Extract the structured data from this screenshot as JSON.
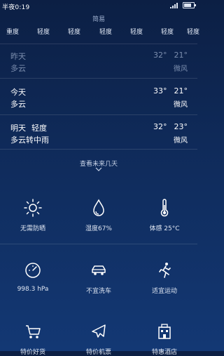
{
  "status_bar": {
    "time": "半夜0:19"
  },
  "hourly": {
    "caption": "简易",
    "items": [
      "重度",
      "轻度",
      "轻度",
      "轻度",
      "轻度",
      "轻度",
      "轻度"
    ]
  },
  "days": [
    {
      "name": "昨天",
      "aqi": "",
      "condition": "多云",
      "high": "32°",
      "low": "21°",
      "wind": "微风",
      "past": true
    },
    {
      "name": "今天",
      "aqi": "",
      "condition": "多云",
      "high": "33°",
      "low": "21°",
      "wind": "微风",
      "past": false
    },
    {
      "name": "明天",
      "aqi": "轻度",
      "condition": "多云转中雨",
      "high": "32°",
      "low": "23°",
      "wind": "微风",
      "past": false
    }
  ],
  "more_label": "查看未来几天",
  "details": [
    {
      "icon": "sun-icon",
      "label": "无需防晒"
    },
    {
      "icon": "humidity-drop-icon",
      "label": "湿度67%"
    },
    {
      "icon": "thermometer-icon",
      "label": "体感 25°C"
    },
    {
      "icon": "pressure-gauge-icon",
      "label": "998.3 hPa"
    },
    {
      "icon": "car-icon",
      "label": "不宜洗车"
    },
    {
      "icon": "running-icon",
      "label": "适宜运动"
    },
    {
      "icon": "shopping-cart-icon",
      "label": "特价好货"
    },
    {
      "icon": "airplane-icon",
      "label": "特价机票"
    },
    {
      "icon": "hotel-icon",
      "label": "特惠酒店"
    }
  ],
  "colors": {
    "bg_top": "#0c1f44",
    "bg_bottom": "#133874",
    "text": "#ffffff",
    "muted": "#7c8eae"
  }
}
